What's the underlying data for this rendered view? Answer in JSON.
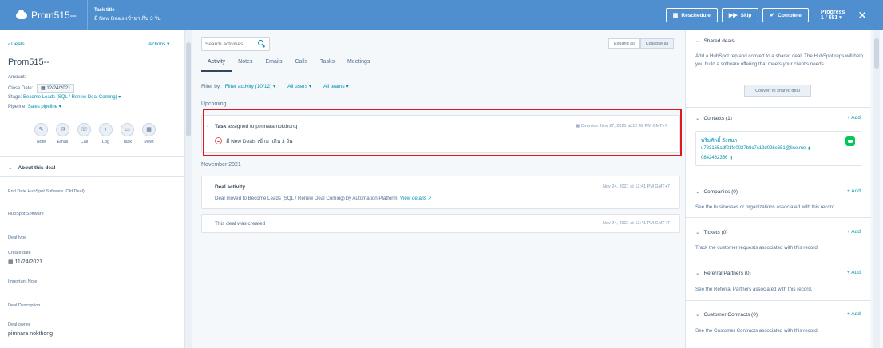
{
  "header": {
    "brand": "Prom515--",
    "task_title_label": "Task title",
    "task_title_value": "มี New Deals เข้ามาเกิน 3 วัน",
    "reschedule_label": "Reschedule",
    "skip_label": "Skip",
    "complete_label": "Complete",
    "progress_label": "Progress",
    "progress_value": "1 / 581 ▾"
  },
  "left": {
    "deals_link": "‹ Deals",
    "actions_link": "Actions ▾",
    "deal_name": "Prom515--",
    "amount": "Amount: --",
    "close_date_label": "Close Date:",
    "close_date_value": "12/24/2021",
    "stage_label": "Stage:",
    "stage_value": "Become Leads (SQL / Renew Deal Coming) ▾",
    "pipeline_label": "Pipeline:",
    "pipeline_value": "Sales pipeline ▾",
    "actions": [
      {
        "label": "Note",
        "icon": "✎"
      },
      {
        "label": "Email",
        "icon": "✉"
      },
      {
        "label": "Call",
        "icon": "☏"
      },
      {
        "label": "Log",
        "icon": "+"
      },
      {
        "label": "Task",
        "icon": "▭"
      },
      {
        "label": "Meet",
        "icon": "▦"
      }
    ],
    "about_title": "About this deal",
    "props": {
      "end_date": "End Date HubSpot Software (Old Deal)",
      "hubspot_software": "HubSpot Software",
      "deal_type": "Deal type",
      "create_date_label": "Create date",
      "create_date_value": "11/24/2021",
      "important_note": "Important Note",
      "deal_description": "Deal Description",
      "deal_owner_label": "Deal owner",
      "deal_owner_value": "pimnara nokthong"
    }
  },
  "mid": {
    "search_placeholder": "Search activities",
    "expand_all": "Expand all",
    "collapse_all": "Collapse all",
    "tabs": [
      "Activity",
      "Notes",
      "Emails",
      "Calls",
      "Tasks",
      "Meetings"
    ],
    "filter_by": "Filter by:",
    "filter_activity": "Filter activity (10/12) ▾",
    "all_users": "All users ▾",
    "all_teams": "All teams ▾",
    "upcoming": "Upcoming",
    "task": {
      "prefix": "Task",
      "assigned": "assigned to pimnara nokthong",
      "title": "มี New Deals เข้ามาเกิน 3 วัน",
      "overdue": "Overdue: Nov 27, 2021 at 12:42 PM GMT+7"
    },
    "month": "November 2021",
    "deal_activity": {
      "title": "Deal activity",
      "body": "Deal moved to Become Leads (SQL / Renew Deal Coming) by Automation Platform.",
      "link": "View details ↗",
      "time": "Nov 24, 2021 at 12:41 PM GMT+7"
    },
    "created": {
      "text": "This deal was created",
      "time": "Nov 24, 2021 at 12:41 PM GMT+7"
    }
  },
  "right": {
    "shared_title": "Shared deals",
    "shared_text": "Add a HubSpot rep and convert to a shared deal. The HubSpot reps will help you build a software offering that meets your client's needs.",
    "convert_btn": "Convert to shared deal",
    "contacts_title": "Contacts (1)",
    "add": "+ Add",
    "contact_name": "พริมศักดิ์ อังสนา",
    "contact_email": "u783165adf21fe0027b8c7c19d026c651@line.me",
    "contact_phone": "0842462356",
    "companies_title": "Companies (0)",
    "companies_text": "See the businesses or organizations associated with this record.",
    "tickets_title": "Tickets (0)",
    "tickets_text": "Track the customer requests associated with this record.",
    "referral_title": "Referral Partners (0)",
    "referral_text": "See the Referral Partners associated with this record.",
    "contracts_title": "Customer Contracts (0)",
    "contracts_text": "See the Customer Contracts associated with this record."
  },
  "colors": {
    "header": "#4f8fcf",
    "link": "#0091ae",
    "highlight": "#e3161d",
    "line": "#06c755"
  }
}
